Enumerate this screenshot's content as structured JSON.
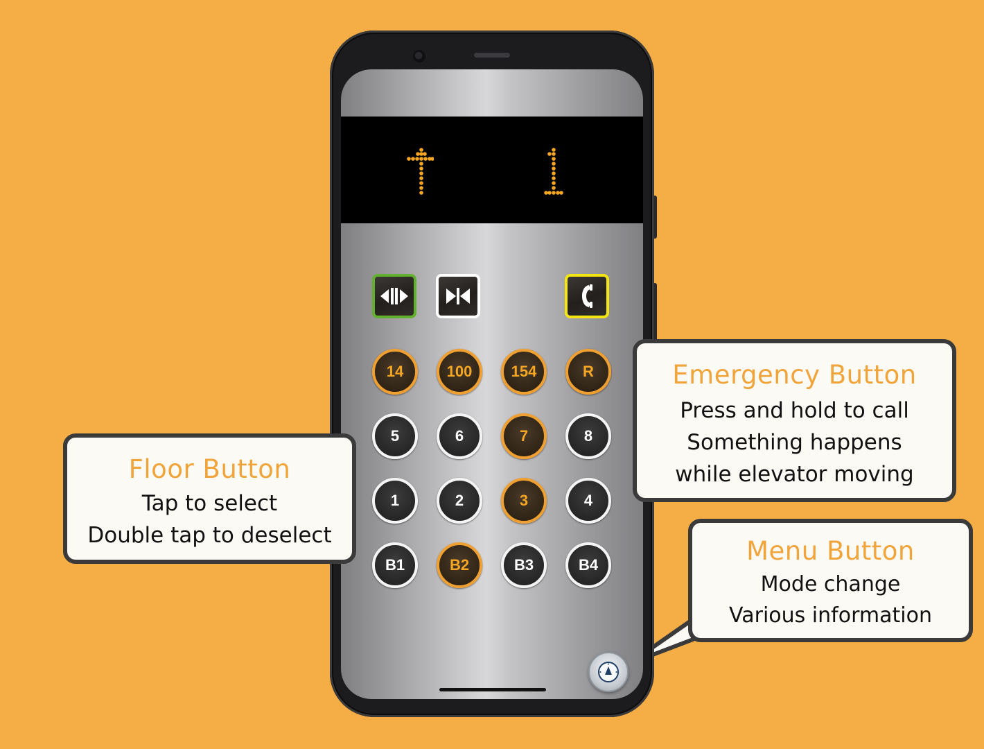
{
  "colors": {
    "background": "#F5AE45",
    "accent": "#F0A43A",
    "led": "#F5A623",
    "selected_ring": "#F0A030",
    "open_border": "#62B02E",
    "emergency_border": "#F2E511"
  },
  "display": {
    "direction": "up",
    "floor": "1"
  },
  "controls": [
    {
      "name": "door-open-button",
      "icon": "door-open-icon"
    },
    {
      "name": "door-close-button",
      "icon": "door-close-icon"
    },
    {
      "name": "emergency-call-button",
      "icon": "phone-icon"
    }
  ],
  "floors": [
    {
      "label": "14",
      "selected": true
    },
    {
      "label": "100",
      "selected": true
    },
    {
      "label": "154",
      "selected": true
    },
    {
      "label": "R",
      "selected": true
    },
    {
      "label": "5",
      "selected": false
    },
    {
      "label": "6",
      "selected": false
    },
    {
      "label": "7",
      "selected": true
    },
    {
      "label": "8",
      "selected": false
    },
    {
      "label": "1",
      "selected": false
    },
    {
      "label": "2",
      "selected": false
    },
    {
      "label": "3",
      "selected": true
    },
    {
      "label": "4",
      "selected": false
    },
    {
      "label": "B1",
      "selected": false
    },
    {
      "label": "B2",
      "selected": true
    },
    {
      "label": "B3",
      "selected": false
    },
    {
      "label": "B4",
      "selected": false
    }
  ],
  "menu_button": {
    "icon": "compass-icon"
  },
  "callouts": {
    "floor": {
      "title": "Floor Button",
      "lines": [
        "Tap to select",
        "Double tap to deselect"
      ]
    },
    "emergency": {
      "title": "Emergency Button",
      "lines": [
        "Press and hold to call",
        "Something happens",
        "while elevator moving"
      ]
    },
    "menu": {
      "title": "Menu Button",
      "lines": [
        "Mode change",
        "Various information"
      ]
    }
  }
}
